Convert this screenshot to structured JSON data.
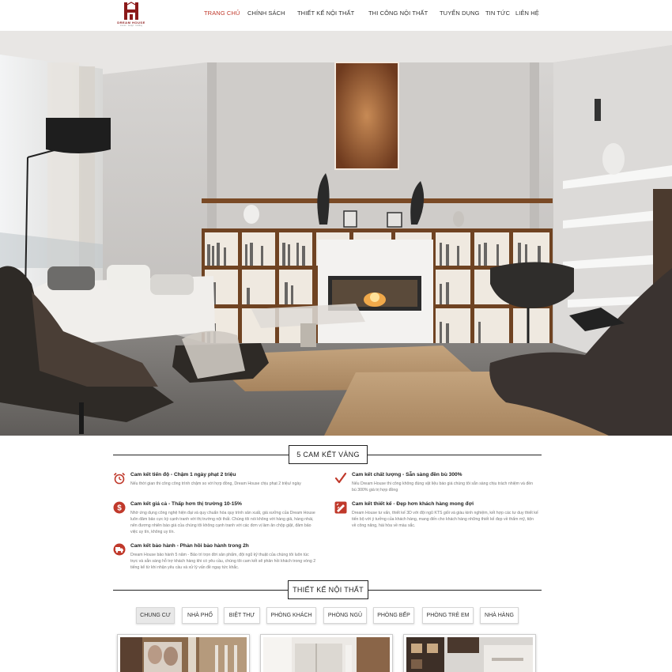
{
  "brand": {
    "name": "DREAM HOUSE",
    "tagline": "interior · design · building",
    "accent": "#8b1a1a"
  },
  "nav": {
    "items": [
      {
        "label": "Trang chủ",
        "active": true
      },
      {
        "label": "Chính sách",
        "active": false
      },
      {
        "label": "Thiết kế nội thất",
        "active": false
      },
      {
        "label": "Thi công nội thất",
        "active": false
      },
      {
        "label": "Tuyển dụng",
        "active": false
      },
      {
        "label": "Tin tức",
        "active": false
      },
      {
        "label": "Liên hệ",
        "active": false
      }
    ],
    "active_color": "#c0392b"
  },
  "commitments": {
    "title": "5 Cam kết vàng",
    "items": [
      {
        "icon": "alarm-clock-icon",
        "title": "Cam kết tiến độ - Chậm 1 ngày phạt 2 triệu",
        "desc": "Nếu thời gian thi công công trình chậm so với hợp đồng, Dream House chịu phạt 2 triệu/ ngày"
      },
      {
        "icon": "checkmark-icon",
        "title": "Cam kết chất lượng - Sẵn sàng đền bù 300%",
        "desc": "Nếu Dream House thi công không đúng vật liệu báo giá chúng tôi sẵn sàng chịu trách nhiệm và đền bù 300% giá trị hợp đồng"
      },
      {
        "icon": "dollar-icon",
        "title": "Cam kết giá cả - Thấp hơn thị trường 10-15%",
        "desc": "Nhờ ứng dụng công nghệ hiện đại và quy chuẩn hóa quy trình sản xuất, giá xưởng của Dream House luôn đảm bảo cực kỳ cạnh tranh với thị trường nội thất. Chúng tôi nói không với hàng giả, hàng nhái, nên đương nhiên báo giá của chúng tôi không cạnh tranh với các đơn vị làm ăn chộp giật, đảm bảo việc uy tín, không uy tín."
      },
      {
        "icon": "pencil-ruler-icon",
        "title": "Cam kết thiết kế - Đẹp hơn khách hàng mong đợi",
        "desc": "Dream House tư vấn, thiết kế 3D với đội ngũ KTS giỏi và giàu kinh nghiệm, kết hợp các tư duy thiết kế tiến bộ với ý tưởng của khách hàng, mang đến cho khách hàng những thiết kế đẹp về thẩm mỹ, tiện về công năng, hài hòa về màu sắc."
      },
      {
        "icon": "truck-icon",
        "title": "Cam kết bảo hành - Phản hồi bảo hành trong 2h",
        "desc": "Dream House bảo hành 5 năm - Bảo trì trọn đời sản phẩm, đội ngũ kỹ thuật của chúng tôi luôn túc trực và sẵn sàng hỗ trợ khách hàng khi có yêu cầu, chúng tôi cam kết sẽ phản hồi khách trong vòng 2 tiếng kể từ khi nhận yêu cầu và xử lý vấn đề ngay tức khắc."
      }
    ]
  },
  "interior": {
    "title": "Thiết kế nội thất",
    "tabs": [
      {
        "label": "Chung cư",
        "active": true
      },
      {
        "label": "Nhà phố",
        "active": false
      },
      {
        "label": "Biệt thự",
        "active": false
      },
      {
        "label": "Phòng khách",
        "active": false
      },
      {
        "label": "Phòng ngủ",
        "active": false
      },
      {
        "label": "Phòng bếp",
        "active": false
      },
      {
        "label": "Phòng trẻ em",
        "active": false
      },
      {
        "label": "Nhà hàng",
        "active": false
      }
    ]
  },
  "colors": {
    "icon_red": "#c0392b",
    "text_dark": "#222222",
    "text_muted": "#777777"
  }
}
